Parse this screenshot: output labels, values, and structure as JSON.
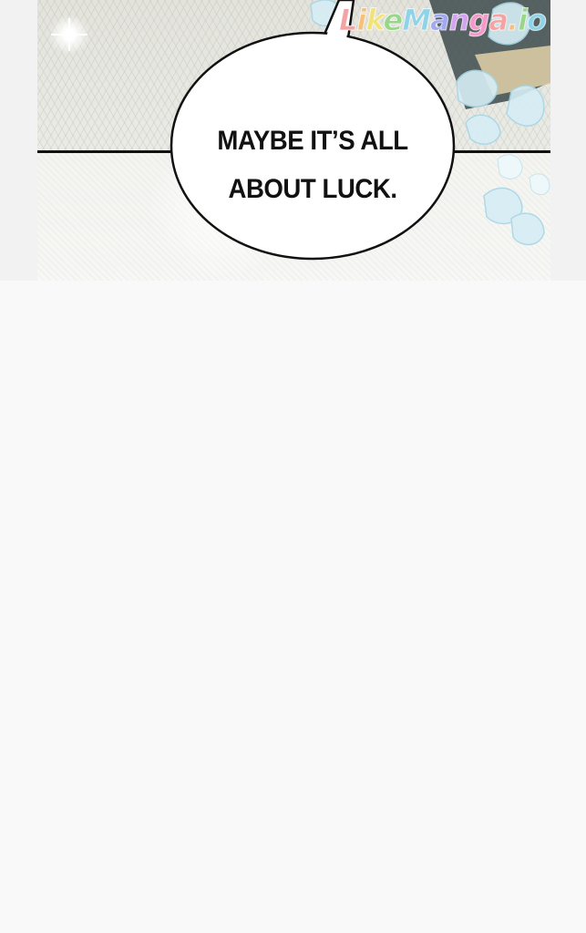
{
  "speech_bubble": {
    "line1": "MAYBE IT’S ALL",
    "line2": "ABOUT LUCK."
  },
  "watermark": {
    "text": "LikeManga.io",
    "colors": [
      "#f4a3a3",
      "#f7c07a",
      "#f1e27a",
      "#9ad68a",
      "#8fd3e8",
      "#a3a9f0",
      "#d2a3ef",
      "#f49ac8",
      "#f4a3a3",
      "#f7c07a",
      "#9ad68a",
      "#8fd3e8"
    ]
  },
  "colors": {
    "ink": "#111111",
    "page_background": "#f9f9f9",
    "bubble_fill": "#ffffff"
  }
}
